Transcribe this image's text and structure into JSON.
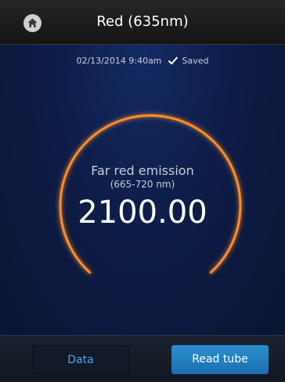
{
  "header": {
    "title": "Red (635nm)",
    "home_icon": "home-icon"
  },
  "status": {
    "timestamp": "02/13/2014 9:40am",
    "saved_label": "Saved",
    "saved_icon": "check-icon"
  },
  "measurement": {
    "label": "Far red emission",
    "range": "(665-720 nm)",
    "value": "2100.00"
  },
  "buttons": {
    "data_label": "Data",
    "read_label": "Read tube"
  },
  "colors": {
    "accent_orange": "#ff8c2a",
    "button_blue": "#2a8fd0",
    "data_text_blue": "#4aa8ea"
  }
}
